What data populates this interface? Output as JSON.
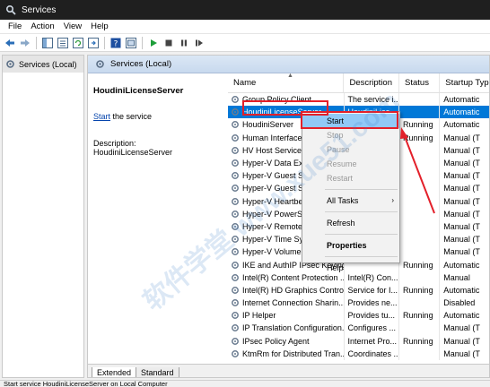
{
  "window": {
    "title": "Services"
  },
  "menu": [
    "File",
    "Action",
    "View",
    "Help"
  ],
  "nav": {
    "item": "Services (Local)"
  },
  "main": {
    "header": "Services (Local)",
    "selected_service": "HoudiniLicenseServer",
    "action_link": "Start",
    "action_suffix": " the service",
    "description_label": "Description:",
    "description_value": "HoudiniLicenseServer"
  },
  "columns": {
    "name": "Name",
    "description": "Description",
    "status": "Status",
    "startup": "Startup Typ"
  },
  "rows": [
    {
      "name": "Group Policy Client",
      "description": "The service i...",
      "status": "",
      "startup": "Automatic"
    },
    {
      "name": "HoudiniLicenseServer",
      "description": "HoudiniLice...",
      "status": "",
      "startup": "Automatic"
    },
    {
      "name": "HoudiniServer",
      "description": "",
      "status": "Running",
      "startup": "Automatic"
    },
    {
      "name": "Human Interface",
      "description": "",
      "status": "Running",
      "startup": "Manual (T"
    },
    {
      "name": "HV Host Service",
      "description": "",
      "status": "",
      "startup": "Manual (T"
    },
    {
      "name": "Hyper-V Data Ex",
      "description": "",
      "status": "",
      "startup": "Manual (T"
    },
    {
      "name": "Hyper-V Guest S",
      "description": "",
      "status": "",
      "startup": "Manual (T"
    },
    {
      "name": "Hyper-V Guest S",
      "description": "",
      "status": "",
      "startup": "Manual (T"
    },
    {
      "name": "Hyper-V Heartbe",
      "description": "",
      "status": "",
      "startup": "Manual (T"
    },
    {
      "name": "Hyper-V PowerS",
      "description": "",
      "status": "",
      "startup": "Manual (T"
    },
    {
      "name": "Hyper-V Remote",
      "description": "",
      "status": "",
      "startup": "Manual (T"
    },
    {
      "name": "Hyper-V Time Sy",
      "description": "",
      "status": "",
      "startup": "Manual (T"
    },
    {
      "name": "Hyper-V Volume",
      "description": "",
      "status": "",
      "startup": "Manual (T"
    },
    {
      "name": "IKE and AuthIP IPsec Keying...",
      "description": "",
      "status": "Running",
      "startup": "Automatic"
    },
    {
      "name": "Intel(R) Content Protection ...",
      "description": "Intel(R) Con...",
      "status": "",
      "startup": "Manual"
    },
    {
      "name": "Intel(R) HD Graphics Contro...",
      "description": "Service for I...",
      "status": "Running",
      "startup": "Automatic"
    },
    {
      "name": "Internet Connection Sharin...",
      "description": "Provides ne...",
      "status": "",
      "startup": "Disabled"
    },
    {
      "name": "IP Helper",
      "description": "Provides tu...",
      "status": "Running",
      "startup": "Automatic"
    },
    {
      "name": "IP Translation Configuration...",
      "description": "Configures ...",
      "status": "",
      "startup": "Manual (T"
    },
    {
      "name": "IPsec Policy Agent",
      "description": "Internet Pro...",
      "status": "Running",
      "startup": "Manual (T"
    },
    {
      "name": "KtmRm for Distributed Tran...",
      "description": "Coordinates ...",
      "status": "",
      "startup": "Manual (T"
    }
  ],
  "context_menu": {
    "start": "Start",
    "stop": "Stop",
    "pause": "Pause",
    "resume": "Resume",
    "restart": "Restart",
    "all_tasks": "All Tasks",
    "refresh": "Refresh",
    "properties": "Properties",
    "help": "Help"
  },
  "tabs": {
    "extended": "Extended",
    "standard": "Standard"
  },
  "statusbar": "Start service HoudiniLicenseServer on Local Computer",
  "watermark": "软件学堂 www.xue51.com",
  "colors": {
    "selection": "#0078d7",
    "highlight": "#e3202a",
    "link": "#0645ad",
    "titlebar": "#1f1f1f"
  }
}
